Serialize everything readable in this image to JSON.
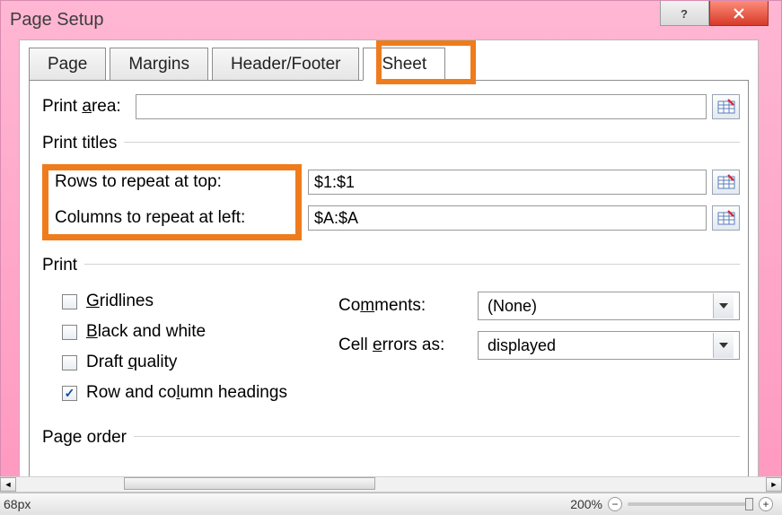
{
  "window": {
    "title": "Page Setup"
  },
  "tabs": [
    {
      "label": "Page"
    },
    {
      "label": "Margins"
    },
    {
      "label": "Header/Footer"
    },
    {
      "label": "Sheet"
    }
  ],
  "print_area": {
    "label_pre": "Print ",
    "label_ul": "a",
    "label_post": "rea:",
    "value": ""
  },
  "print_titles": {
    "heading": "Print titles",
    "rows_label_ul": "R",
    "rows_label_post": "ows to repeat at top:",
    "rows_value": "$1:$1",
    "cols_label_ul": "C",
    "cols_label_post": "olumns to repeat at left:",
    "cols_value": "$A:$A"
  },
  "print_section": {
    "heading": "Print",
    "gridlines_ul": "G",
    "gridlines_post": "ridlines",
    "bw_ul": "B",
    "bw_post": "lack and white",
    "draft_pre": "Draft ",
    "draft_ul": "q",
    "draft_post": "uality",
    "rowcol_pre": "Row and co",
    "rowcol_ul": "l",
    "rowcol_post": "umn headings",
    "comments_label_pre": "Co",
    "comments_label_ul": "m",
    "comments_label_post": "ments:",
    "comments_value": "(None)",
    "cellerr_label_pre": "Cell ",
    "cellerr_label_ul": "e",
    "cellerr_label_post": "rrors as:",
    "cellerr_value": "displayed"
  },
  "page_order": {
    "heading": "Page order"
  },
  "statusbar": {
    "px": "68px",
    "zoom": "200%"
  }
}
